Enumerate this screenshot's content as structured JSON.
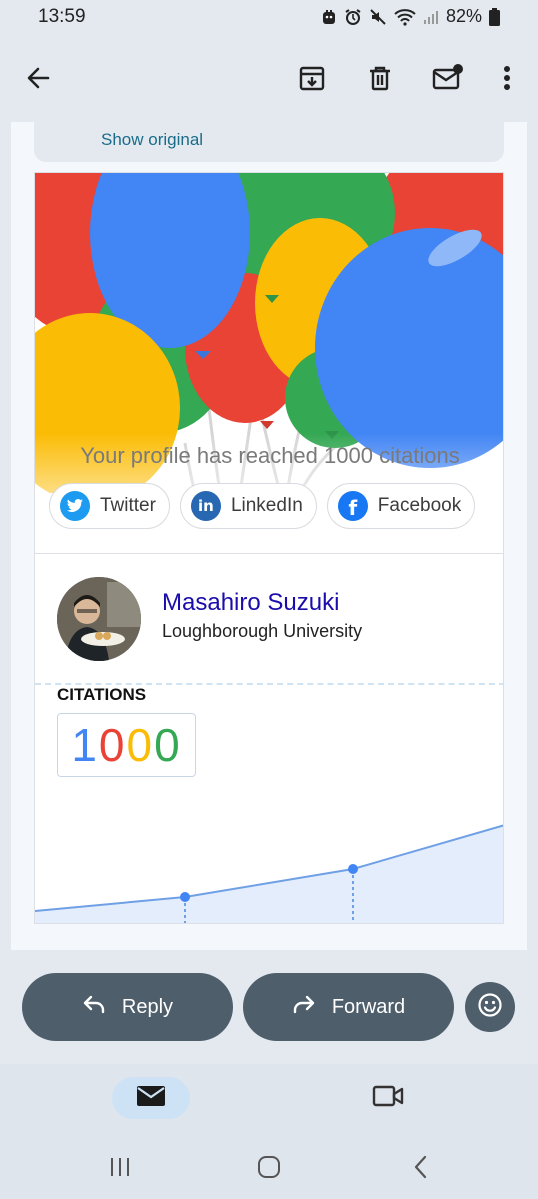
{
  "status_bar": {
    "time": "13:59",
    "battery": "82%",
    "icons": [
      "pet-notification-icon",
      "alarm-icon",
      "mute-icon",
      "wifi-icon",
      "signal-icon",
      "battery-icon"
    ]
  },
  "top_bar": {
    "icons": [
      "back-arrow-icon",
      "archive-icon",
      "delete-icon",
      "mark-unread-icon",
      "more-vert-icon"
    ]
  },
  "email": {
    "show_original": "Show original",
    "headline": "Your profile has reached 1000 citations",
    "share": {
      "twitter": "Twitter",
      "linkedin": "LinkedIn",
      "facebook": "Facebook"
    },
    "profile": {
      "name": "Masahiro Suzuki",
      "affiliation": "Loughborough University"
    },
    "citations_label": "CITATIONS",
    "citations_digits": [
      "1",
      "0",
      "0",
      "0"
    ],
    "digit_colors": [
      "#4285f4",
      "#ea4335",
      "#fbbc05",
      "#34a853"
    ]
  },
  "actions": {
    "reply": "Reply",
    "forward": "Forward"
  },
  "bottom_nav": {
    "items": [
      "mail-icon",
      "meet-video-icon"
    ]
  },
  "colors": {
    "accent": "#1a0dab",
    "action_button": "#4e5e6b",
    "chart_line": "#6fa0e6",
    "chart_fill": "#e3edfb"
  }
}
